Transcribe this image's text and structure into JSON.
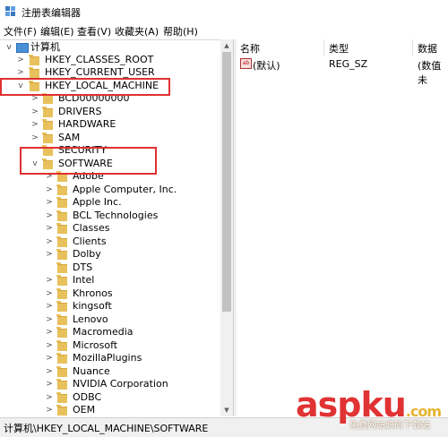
{
  "window": {
    "title": "注册表编辑器"
  },
  "menu": [
    "文件(F)",
    "编辑(E)",
    "查看(V)",
    "收藏夹(A)",
    "帮助(H)"
  ],
  "tree": {
    "root": "计算机",
    "items": [
      {
        "label": "HKEY_CLASSES_ROOT"
      },
      {
        "label": "HKEY_CURRENT_USER"
      },
      {
        "label": "HKEY_LOCAL_MACHINE"
      },
      {
        "label": "BCD00000000"
      },
      {
        "label": "DRIVERS"
      },
      {
        "label": "HARDWARE"
      },
      {
        "label": "SAM"
      },
      {
        "label": "SECURITY"
      },
      {
        "label": "SOFTWARE"
      },
      {
        "label": "Adobe"
      },
      {
        "label": "Apple Computer, Inc."
      },
      {
        "label": "Apple Inc."
      },
      {
        "label": "BCL Technologies"
      },
      {
        "label": "Classes"
      },
      {
        "label": "Clients"
      },
      {
        "label": "Dolby"
      },
      {
        "label": "DTS"
      },
      {
        "label": "Intel"
      },
      {
        "label": "Khronos"
      },
      {
        "label": "kingsoft"
      },
      {
        "label": "Lenovo"
      },
      {
        "label": "Macromedia"
      },
      {
        "label": "Microsoft"
      },
      {
        "label": "MozillaPlugins"
      },
      {
        "label": "Nuance"
      },
      {
        "label": "NVIDIA Corporation"
      },
      {
        "label": "ODBC"
      },
      {
        "label": "OEM"
      }
    ]
  },
  "list": {
    "columns": [
      "名称",
      "类型",
      "数据"
    ],
    "rows": [
      {
        "name": "(默认)",
        "type": "REG_SZ",
        "data": "(数值未"
      }
    ]
  },
  "status": {
    "path": "计算机\\HKEY_LOCAL_MACHINE\\SOFTWARE"
  },
  "watermark": {
    "main": "aspku",
    "com": ".com",
    "sub": "免费网站源码下载站"
  },
  "colors": {
    "highlight": "#e03030",
    "folder": "#e8c15c"
  }
}
